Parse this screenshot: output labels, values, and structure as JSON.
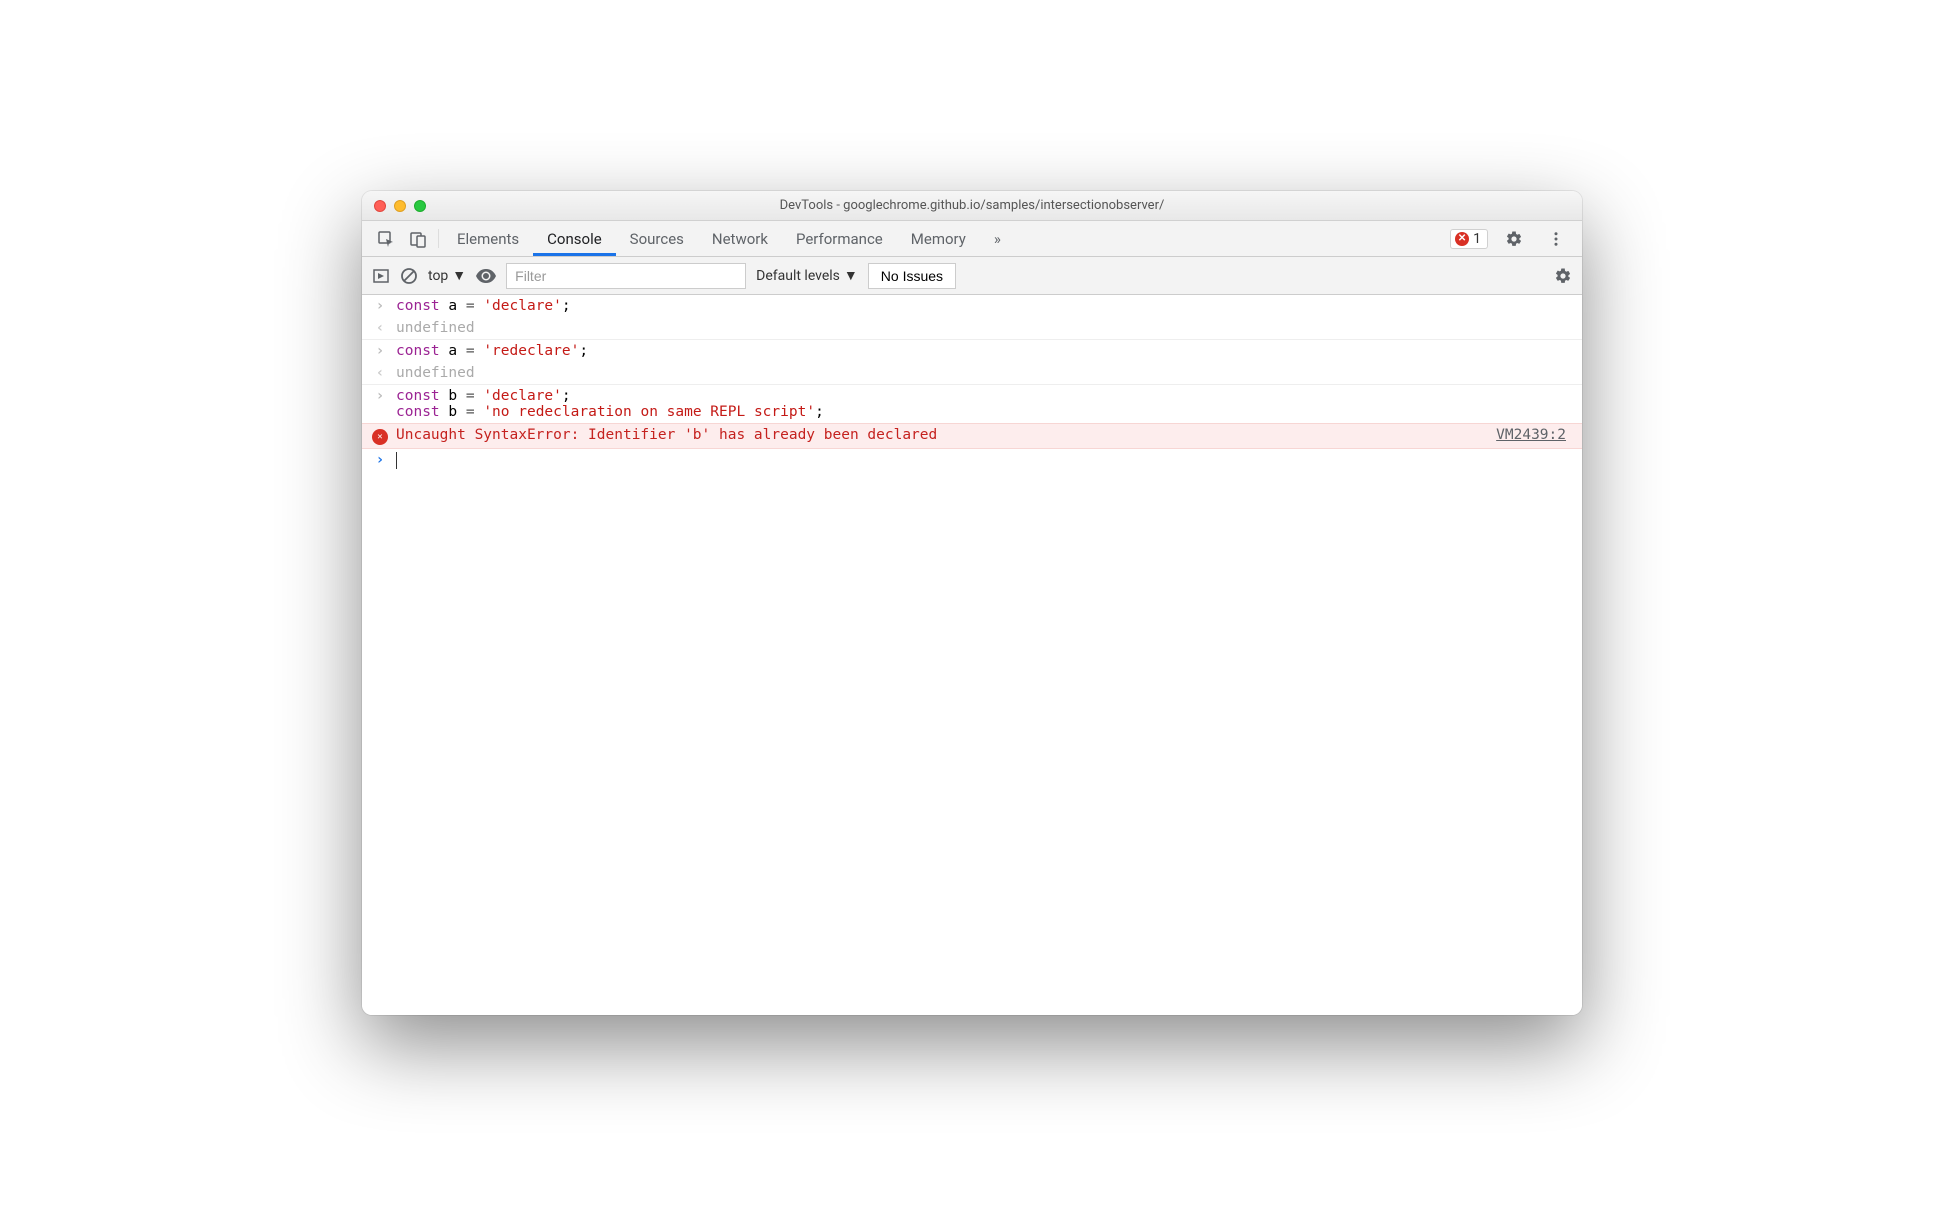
{
  "window": {
    "title": "DevTools - googlechrome.github.io/samples/intersectionobserver/"
  },
  "tabs": {
    "items": [
      "Elements",
      "Console",
      "Sources",
      "Network",
      "Performance",
      "Memory"
    ],
    "active_index": 1,
    "overflow_glyph": "»",
    "error_badge_count": "1"
  },
  "toolbar": {
    "context": "top",
    "filter_placeholder": "Filter",
    "levels": "Default levels",
    "issues_button": "No Issues"
  },
  "console": {
    "entries": [
      {
        "type": "input",
        "code": [
          {
            "kw": "const"
          },
          {
            "t": " a "
          },
          {
            "eq": "="
          },
          {
            "t": " "
          },
          {
            "str": "'declare'"
          },
          {
            "t": ";"
          }
        ]
      },
      {
        "type": "output",
        "text": "undefined"
      },
      {
        "type": "input",
        "code": [
          {
            "kw": "const"
          },
          {
            "t": " a "
          },
          {
            "eq": "="
          },
          {
            "t": " "
          },
          {
            "str": "'redeclare'"
          },
          {
            "t": ";"
          }
        ]
      },
      {
        "type": "output",
        "text": "undefined"
      },
      {
        "type": "input-multiline",
        "lines": [
          [
            {
              "kw": "const"
            },
            {
              "t": " b "
            },
            {
              "eq": "="
            },
            {
              "t": " "
            },
            {
              "str": "'declare'"
            },
            {
              "t": ";"
            }
          ],
          [
            {
              "kw": "const"
            },
            {
              "t": " b "
            },
            {
              "eq": "="
            },
            {
              "t": " "
            },
            {
              "str": "'no redeclaration on same REPL script'"
            },
            {
              "t": ";"
            }
          ]
        ]
      },
      {
        "type": "error",
        "text": "Uncaught SyntaxError: Identifier 'b' has already been declared",
        "source": "VM2439:2"
      }
    ]
  }
}
